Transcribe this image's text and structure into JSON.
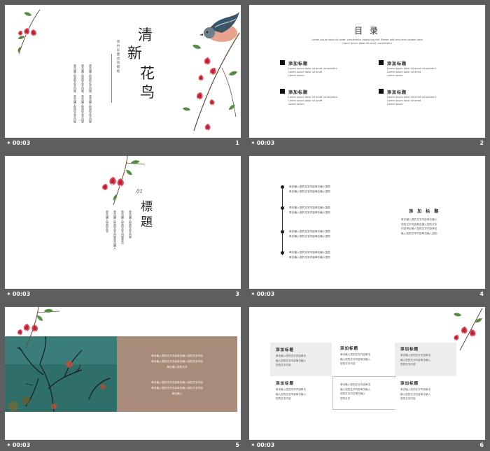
{
  "colors": {
    "background": "#5e5e5e",
    "slide": "#ffffff",
    "teal": "#2e6f6a",
    "tan": "#a88b78",
    "flower": "#d93a4d",
    "leaf": "#4d8a3b"
  },
  "slides": [
    {
      "timing": "00:03",
      "number": "1",
      "title_chars": [
        "清",
        "新",
        "花",
        "鸟"
      ],
      "subtitle_vertical": "简约彩墨古风模板",
      "body_lines": [
        "单击输入您的文字内容，单击输入您的文字内容",
        "单击输入您的文字内容，单击输入您的文字内容",
        "单击输入您的文字内容，单击输入您的文字内容"
      ]
    },
    {
      "timing": "00:03",
      "number": "2",
      "title": "目 录",
      "subtitle_lines": [
        "Lorem ipsum dolor sit amet, consectetur adipiscing elit. Please add your text content here",
        "Lorem ipsum dolor sit amet, consectetur"
      ],
      "items": [
        {
          "label": "添加标题",
          "lines": [
            "Lorem ipsum dolor sit amet consectetur",
            "Lorem ipsum dolor sit amet",
            "Lorem ipsum"
          ]
        },
        {
          "label": "添加标题",
          "lines": [
            "Lorem ipsum dolor sit amet consectetur",
            "Lorem ipsum dolor sit amet",
            "Lorem ipsum"
          ]
        },
        {
          "label": "添加标题",
          "lines": [
            "Lorem ipsum dolor sit amet consectetur",
            "Lorem ipsum dolor sit amet",
            "Lorem ipsum"
          ]
        },
        {
          "label": "添加标题",
          "lines": [
            "Lorem ipsum dolor sit amet consectetur",
            "Lorem ipsum dolor sit amet",
            "Lorem ipsum"
          ]
        }
      ]
    },
    {
      "timing": "00:03",
      "number": "3",
      "ornament": "01",
      "title_chars": [
        "標",
        "題"
      ],
      "vertical_lines": [
        "单击输入您的文字内容",
        "单击输入您的文字内容单击",
        "单击输入您的文字内容单击输入",
        "单击输入您的文字"
      ]
    },
    {
      "timing": "00:03",
      "number": "4",
      "timeline": [
        {
          "a": "单击输入您的文字内容单击输入您的",
          "b": "单击输入您的文字内容单击输入您的"
        },
        {
          "a": "单击输入您的文字内容单击输入您的",
          "b": "单击输入您的文字内容单击输入您的"
        },
        {
          "a": "单击输入您的文字内容单击输入您的",
          "b": "单击输入您的文字内容单击输入您的"
        },
        {
          "a": "单击输入您的文字内容单击输入您的",
          "b": "单击输入您的文字内容单击输入您的"
        }
      ],
      "side_title": "添 加 标 题",
      "side_lines": [
        "单击输入您的文字内容单击输入",
        "您的文字内容单击输入您的文字",
        "内容单击输入您的文字内容单击",
        "输入您的文字内容单击输入您的"
      ]
    },
    {
      "timing": "00:03",
      "number": "5",
      "panel_lines_a": [
        "单击输入您的文字内容单击输入您的文字内容",
        "单击输入您的文字内容单击输入您的文字内容",
        "单击输入您的文字"
      ],
      "panel_lines_b": [
        "单击输入您的文字内容单击输入您的文字内容",
        "单击输入您的文字内容单击输入您的文字内容",
        "单击输入"
      ]
    },
    {
      "timing": "00:03",
      "number": "6",
      "cards": [
        {
          "title": "添加标题",
          "lines": [
            "单击输入您的文字内容单击",
            "输入您的文字内容单击输入",
            "您的文字内容"
          ]
        },
        {
          "title": "添加标题",
          "lines": [
            "单击输入您的文字内容单击",
            "输入您的文字内容单击输入",
            "您的文字内容"
          ]
        },
        {
          "title": "添加标题",
          "lines": [
            "单击输入您的文字内容单击",
            "输入您的文字内容单击输入",
            "您的文字内容"
          ]
        },
        {
          "title": "添加标题",
          "lines": [
            "单击输入您的文字内容单击",
            "输入您的文字内容单击输入",
            "您的文字内容"
          ]
        },
        {
          "title": "",
          "lines": [
            "单击输入您的文字内容单击",
            "输入您的文字内容单击输入",
            "您的文字内容单击输入",
            "您的文字"
          ]
        },
        {
          "title": "添加标题",
          "lines": [
            "单击输入您的文字内容单击",
            "输入您的文字内容单击输入",
            "您的文字内容"
          ]
        }
      ]
    }
  ]
}
